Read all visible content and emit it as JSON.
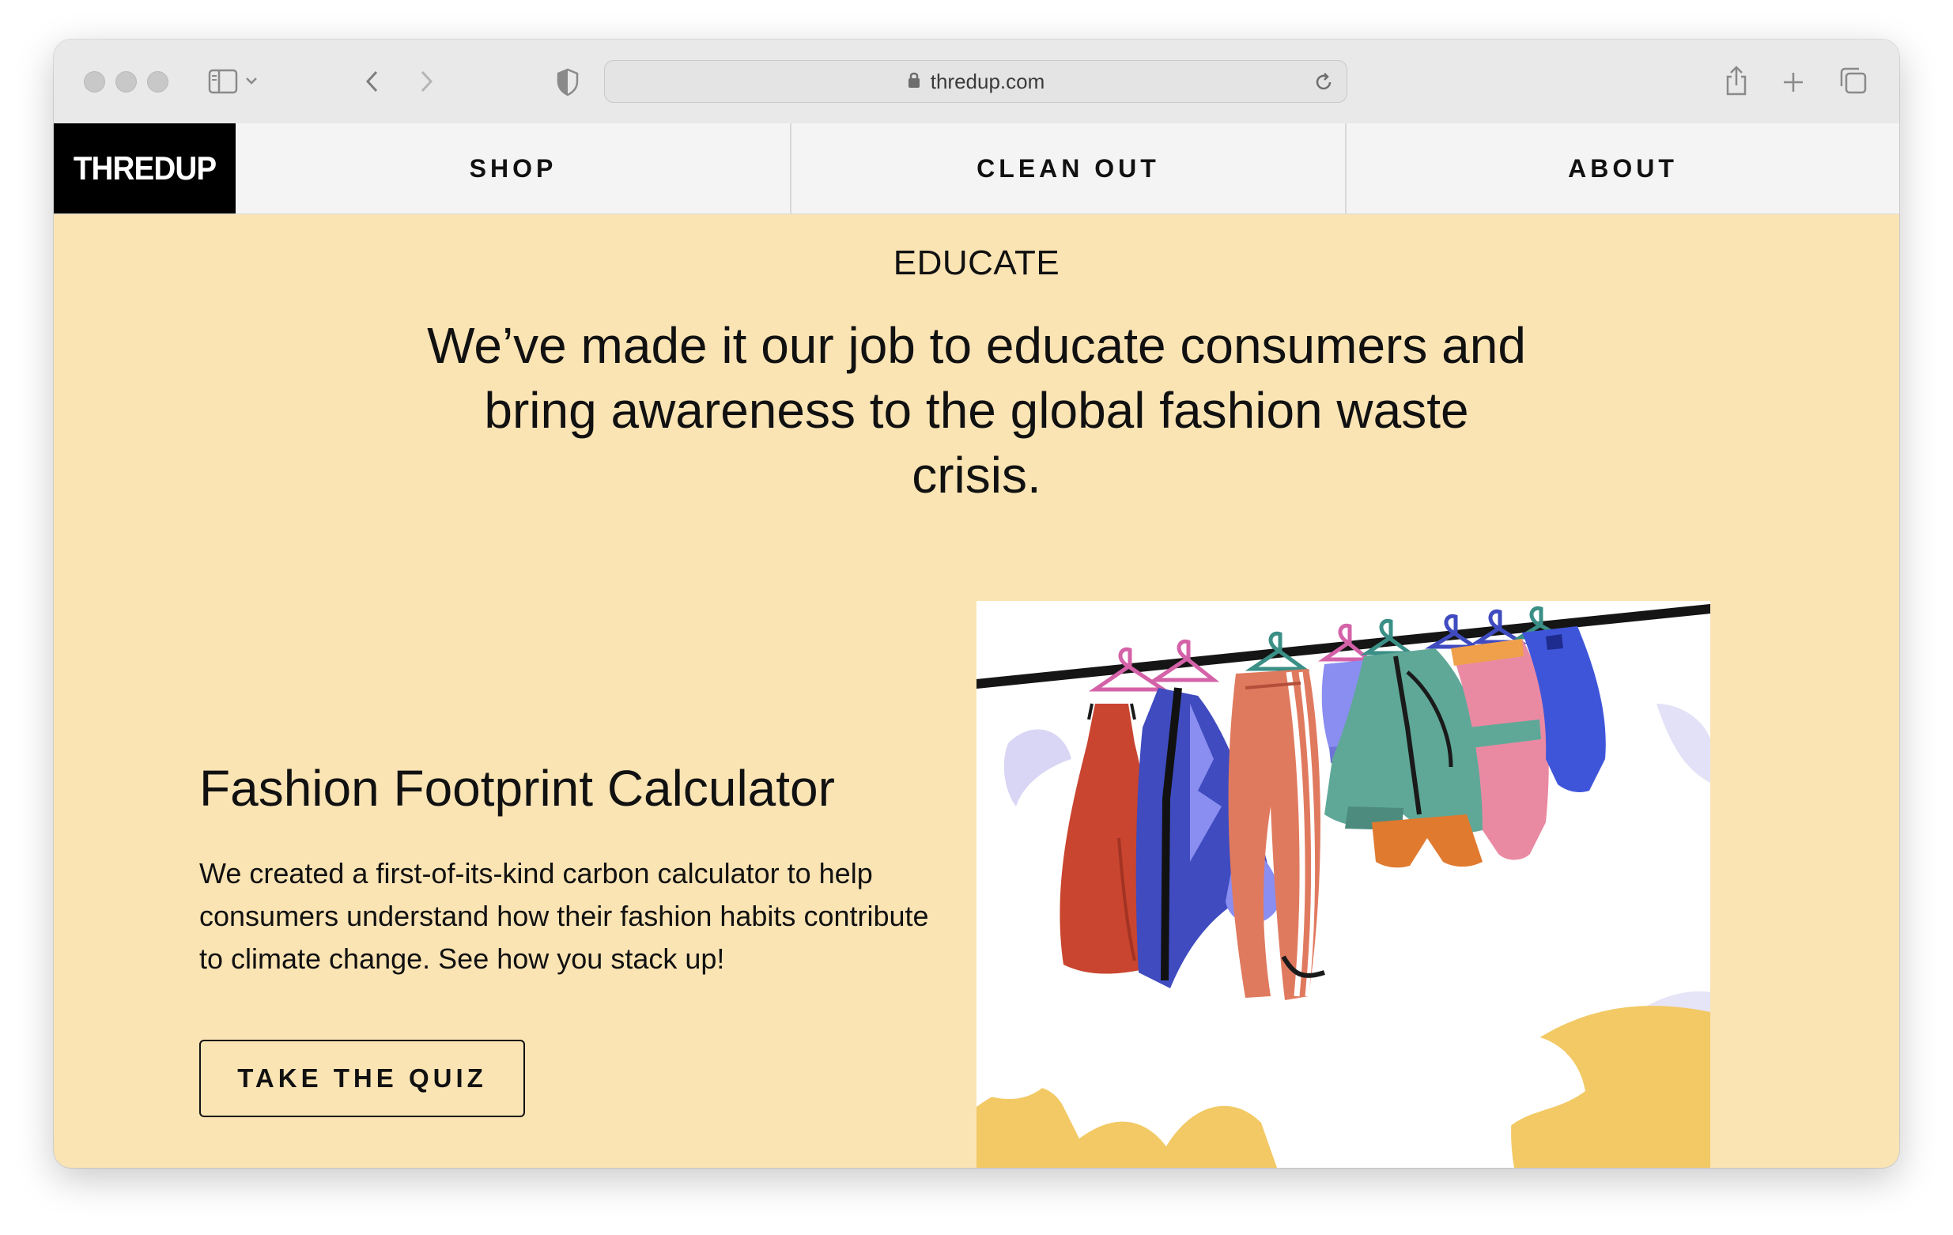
{
  "browser": {
    "url": "thredup.com",
    "icons": {
      "sidebar": "sidebar-icon",
      "chevron": "chevron-down-icon",
      "back": "back-arrow-icon",
      "forward": "forward-arrow-icon",
      "privacy": "shield-icon",
      "lock": "lock-icon",
      "reload": "reload-icon",
      "share": "share-icon",
      "new_tab": "plus-icon",
      "tabs": "tabs-icon"
    }
  },
  "nav": {
    "logo": "THREDUP",
    "items": [
      {
        "label": "SHOP"
      },
      {
        "label": "CLEAN OUT"
      },
      {
        "label": "ABOUT"
      }
    ]
  },
  "hero": {
    "eyebrow": "EDUCATE",
    "headline": "We’ve made it our job to educate consumers and bring awareness to the global fashion waste crisis."
  },
  "card": {
    "title": "Fashion Footprint Calculator",
    "body": "We created a first-of-its-kind carbon calculator to help consumers understand how their fashion habits contribute to climate change. See how you stack up!",
    "button": "TAKE THE QUIZ",
    "illustration": "clothing-rack-illustration"
  },
  "colors": {
    "background": "#fae4b4",
    "nav_bg": "#f4f4f4",
    "logo_bg": "#000000",
    "text": "#111111",
    "yellow_accent": "#f2c964"
  }
}
